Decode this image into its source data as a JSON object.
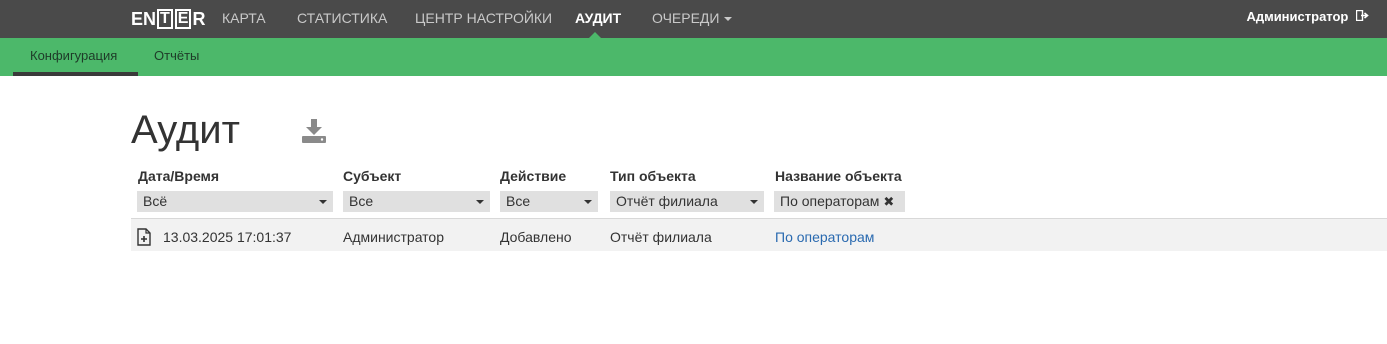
{
  "app": {
    "logo_text": "ENTER"
  },
  "nav": {
    "items": [
      {
        "label": "КАРТА"
      },
      {
        "label": "СТАТИСТИКА"
      },
      {
        "label": "ЦЕНТР НАСТРОЙКИ"
      },
      {
        "label": "АУДИТ",
        "active": true
      },
      {
        "label": "ОЧЕРЕДИ",
        "has_dropdown": true
      }
    ],
    "user_label": "Администратор"
  },
  "subnav": {
    "items": [
      {
        "label": "Конфигурация",
        "active": true
      },
      {
        "label": "Отчёты"
      }
    ]
  },
  "page": {
    "title": "Аудит"
  },
  "table": {
    "columns": [
      {
        "header": "Дата/Время",
        "filter": "Всё"
      },
      {
        "header": "Субъект",
        "filter": "Все"
      },
      {
        "header": "Действие",
        "filter": "Все"
      },
      {
        "header": "Тип объекта",
        "filter": "Отчёт филиала"
      },
      {
        "header": "Название объекта",
        "filter": "По операторам"
      }
    ],
    "rows": [
      {
        "datetime": "13.03.2025 17:01:37",
        "subject": "Администратор",
        "action": "Добавлено",
        "object_type": "Отчёт филиала",
        "object_name": "По операторам"
      }
    ]
  },
  "colors": {
    "topbar": "#4a4a4a",
    "accent_green": "#4cb86a",
    "link": "#2a6ab0"
  },
  "icons": {
    "download": "download-icon",
    "logout": "logout-icon",
    "added_document": "file-plus-icon"
  }
}
